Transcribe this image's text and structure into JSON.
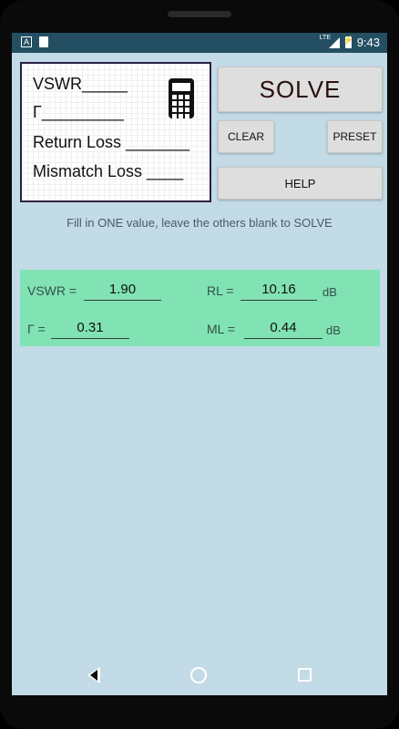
{
  "status_bar": {
    "time": "9:43",
    "network": "LTE",
    "left_icon_letter": "A"
  },
  "logo_card": {
    "lines": [
      "VSWR_____",
      "Γ_________",
      "Return Loss _______",
      "Mismatch Loss ____"
    ],
    "icon": "calculator-icon"
  },
  "buttons": {
    "solve": "SOLVE",
    "clear": "CLEAR",
    "preset": "PRESET",
    "help": "HELP"
  },
  "hint": "Fill in ONE value, leave the others blank to SOLVE",
  "fields": {
    "vswr": {
      "label": "VSWR =",
      "value": "1.90"
    },
    "rl": {
      "label": "RL =",
      "value": "10.16",
      "unit": "dB"
    },
    "gamma": {
      "label": "Γ =",
      "value": "0.31"
    },
    "ml": {
      "label": "ML =",
      "value": "0.44",
      "unit": "dB"
    }
  },
  "nav": {
    "back": "back-icon",
    "home": "home-icon",
    "recents": "recents-icon"
  },
  "colors": {
    "statusbar": "#244f62",
    "background": "#c3dbe6",
    "panel": "#81e3b3",
    "button": "#dedede"
  }
}
